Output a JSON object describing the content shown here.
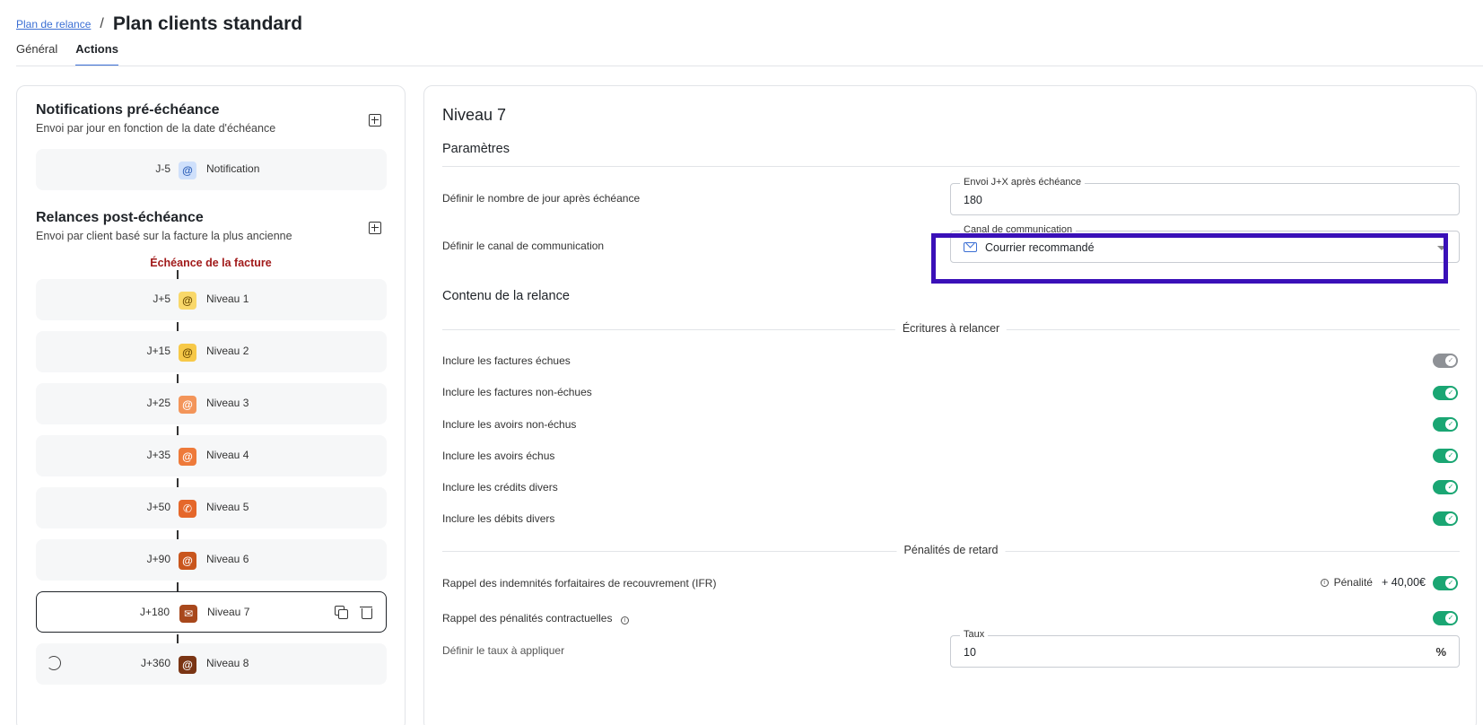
{
  "header": {
    "breadcrumb_link": "Plan de relance",
    "breadcrumb_sep": "/",
    "title": "Plan clients standard"
  },
  "tabs": [
    {
      "label": "Général",
      "active": false
    },
    {
      "label": "Actions",
      "active": true
    }
  ],
  "left": {
    "pre": {
      "title": "Notifications pré-échéance",
      "subtitle": "Envoi par jour en fonction de la date d'échéance",
      "items": [
        {
          "day": "J-5",
          "icon": "@",
          "label": "Notification",
          "icon_bg": "#cfe0fb",
          "icon_color": "#2d5fb8"
        }
      ]
    },
    "post": {
      "title": "Relances post-échéance",
      "subtitle": "Envoi par client basé sur la facture la plus ancienne",
      "due_label": "Échéance de la facture",
      "items": [
        {
          "day": "J+5",
          "icon": "@",
          "label": "Niveau 1",
          "icon_bg": "#f9d86a",
          "icon_color": "#6b4a00"
        },
        {
          "day": "J+15",
          "icon": "@",
          "label": "Niveau 2",
          "icon_bg": "#f7c948",
          "icon_color": "#6b4a00"
        },
        {
          "day": "J+25",
          "icon": "@",
          "label": "Niveau 3",
          "icon_bg": "#f3955a",
          "icon_color": "#ffffff"
        },
        {
          "day": "J+35",
          "icon": "@",
          "label": "Niveau 4",
          "icon_bg": "#ee7a3a",
          "icon_color": "#ffffff"
        },
        {
          "day": "J+50",
          "icon": "✆",
          "label": "Niveau 5",
          "icon_bg": "#e5672a",
          "icon_color": "#ffffff"
        },
        {
          "day": "J+90",
          "icon": "@",
          "label": "Niveau 6",
          "icon_bg": "#c9561d",
          "icon_color": "#ffffff"
        },
        {
          "day": "J+180",
          "icon": "✉",
          "label": "Niveau 7",
          "icon_bg": "#a8481c",
          "icon_color": "#ffffff"
        },
        {
          "day": "J+360",
          "icon": "@",
          "label": "Niveau 8",
          "icon_bg": "#7a3514",
          "icon_color": "#ffffff"
        }
      ]
    }
  },
  "right": {
    "level_title": "Niveau 7",
    "params_title": "Paramètres",
    "days_label": "Définir le nombre de jour après échéance",
    "days_legend": "Envoi J+X après échéance",
    "days_value": "180",
    "channel_label": "Définir le canal de communication",
    "channel_legend": "Canal de communication",
    "channel_value": "Courrier recommandé",
    "content_title": "Contenu de la relance",
    "entries_divider": "Écritures à relancer",
    "entries": [
      {
        "label": "Inclure les factures échues",
        "on": false
      },
      {
        "label": "Inclure les factures non-échues",
        "on": true
      },
      {
        "label": "Inclure les avoirs non-échus",
        "on": true
      },
      {
        "label": "Inclure les avoirs échus",
        "on": true
      },
      {
        "label": "Inclure les crédits divers",
        "on": true
      },
      {
        "label": "Inclure les débits divers",
        "on": true
      }
    ],
    "penalties_divider": "Pénalités de retard",
    "ifr_label": "Rappel des indemnités forfaitaires de recouvrement (IFR)",
    "ifr_penalty_label": "Pénalité",
    "ifr_penalty_amount": "+ 40,00€",
    "contract_label": "Rappel des pénalités contractuelles",
    "rate_label": "Définir le taux à appliquer",
    "rate_legend": "Taux",
    "rate_value": "10",
    "rate_suffix": "%"
  },
  "colors": {
    "accent": "#3b6fd4",
    "toggle_on": "#1aa673",
    "toggle_off": "#8e9196",
    "due_label": "#a11a1a",
    "highlight": "#3a10b8"
  }
}
